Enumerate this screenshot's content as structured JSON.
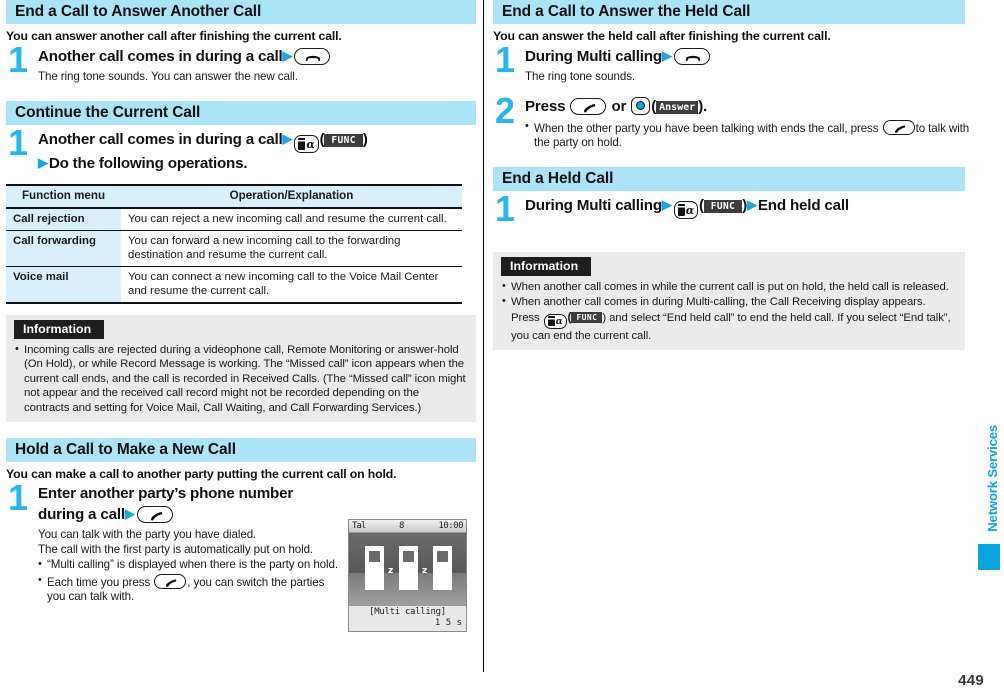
{
  "page": {
    "number": "449",
    "side_tab_label": "Network Services"
  },
  "left_column": {
    "section1": {
      "header": "End a Call to Answer Another Call",
      "lead": "You can answer another call after finishing the current call.",
      "step": {
        "num": "1",
        "title": "Another call comes in during a call",
        "key": "end-call-key",
        "body": "The ring tone sounds. You can answer the new call."
      }
    },
    "section2": {
      "header": "Continue the Current Call",
      "step": {
        "num": "1",
        "title": "Another call comes in during a call",
        "key": "i-alpha-key",
        "softkey": "FUNC",
        "title_line2": "Do the following operations."
      },
      "table": {
        "columns": [
          "Function menu",
          "Operation/Explanation"
        ],
        "rows": [
          {
            "menu": "Call rejection",
            "explanation": "You can reject a new incoming call and resume the current call."
          },
          {
            "menu": "Call forwarding",
            "explanation": "You can forward a new incoming call to the forwarding destination and resume the current call."
          },
          {
            "menu": "Voice mail",
            "explanation": "You can connect a new incoming call to the Voice Mail Center and resume the current call."
          }
        ]
      },
      "information": {
        "tag": "Information",
        "items": [
          "Incoming calls are rejected during a videophone call, Remote Monitoring or answer-hold (On Hold), or while Record Message is working. The “Missed call” icon appears when the current call ends, and the call is recorded in Received Calls. (The “Missed call” icon might not appear and the received call record might not be recorded depending on the contracts and setting for Voice Mail, Call Waiting, and Call Forwarding Services.)"
        ]
      }
    },
    "section3": {
      "header": "Hold a Call to Make a New Call",
      "lead": "You can make a call to another party putting the current call on hold.",
      "step": {
        "num": "1",
        "title_line1": "Enter another party’s phone number",
        "title_line2": "during a call",
        "key": "call-key",
        "body_line1": "You can talk with the party you have dialed.",
        "body_line2": "The call with the first party is automatically put on hold.",
        "bullet1": "“Multi calling” is displayed when there is the party on hold.",
        "bullet2_pre": "Each time you press",
        "bullet2_post": ", you can switch the parties you can talk with."
      },
      "phone_screen": {
        "status_signal": "Tal",
        "status_mid": "8",
        "status_clock": "10:00",
        "caption": "[Multi calling]",
        "timer": "1 5 s"
      }
    }
  },
  "right_column": {
    "section1": {
      "header": "End a Call to Answer the Held Call",
      "lead": "You can answer the held call after finishing the current call.",
      "step1": {
        "num": "1",
        "title": "During Multi calling",
        "key": "end-call-key",
        "body": "The ring tone sounds."
      },
      "step2": {
        "num": "2",
        "title_pre": "Press",
        "title_mid": "or",
        "softkey": "Answer",
        "title_post": ".",
        "bullet_pre": "When the other party you have been talking with ends the call, press",
        "bullet_post": "to talk with the party on hold."
      }
    },
    "section2": {
      "header": "End a Held Call",
      "step": {
        "num": "1",
        "title": "During Multi calling",
        "key": "i-alpha-key",
        "softkey": "FUNC",
        "title_end": "End held call"
      },
      "information": {
        "tag": "Information",
        "item1": "When another call comes in while the current call is put on hold, the held call is released.",
        "item2_a": "When another call comes in during Multi-calling, the Call Receiving display appears. Press",
        "item2_softkey": "FUNC",
        "item2_b": ") and select “End held call” to end the held call. If you select “End talk”, you can end the current call."
      }
    }
  },
  "colors": {
    "accent": "#0aa5e0",
    "header_bar": "#ace4f7",
    "info_bg": "#ebebeb",
    "table_key_bg": "#d9f0fa"
  }
}
